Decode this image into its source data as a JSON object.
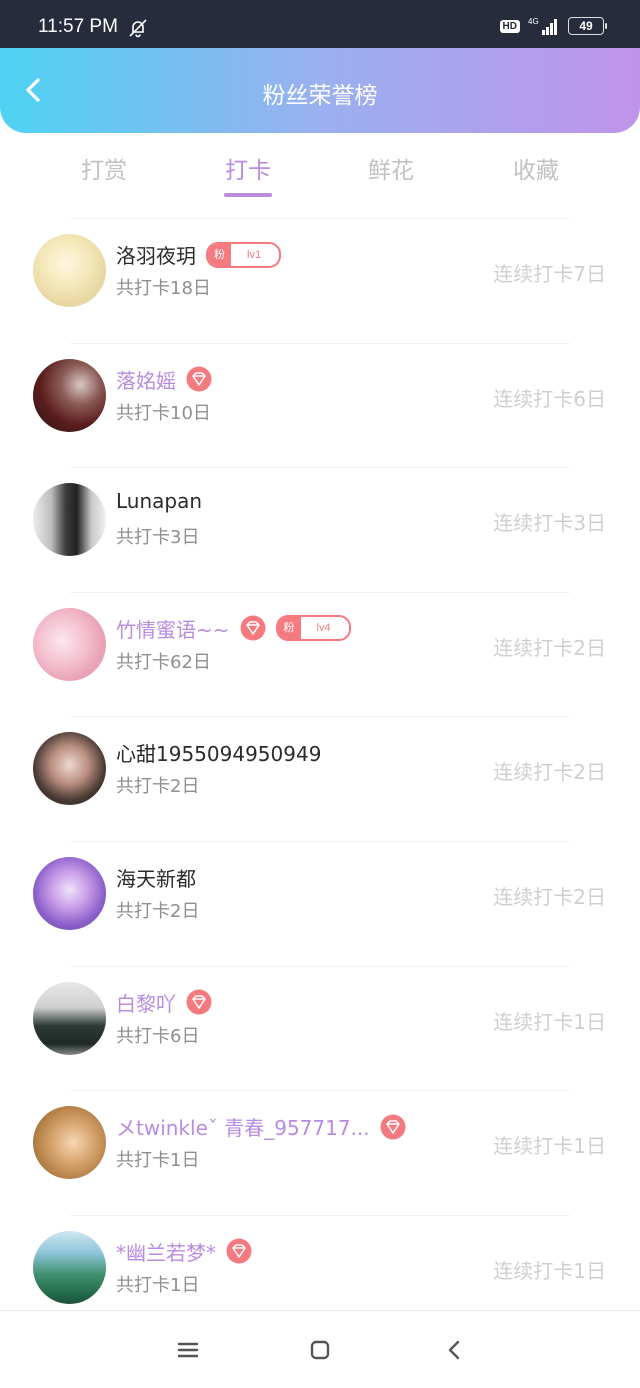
{
  "status_bar": {
    "time": "11:57 PM",
    "mute_icon": "bell-off-icon",
    "hd": "HD",
    "network": "4G",
    "battery": "49"
  },
  "header": {
    "title": "粉丝荣誉榜",
    "back_icon": "chevron-left-icon"
  },
  "tabs": [
    {
      "label": "打赏",
      "active": false
    },
    {
      "label": "打卡",
      "active": true
    },
    {
      "label": "鲜花",
      "active": false
    },
    {
      "label": "收藏",
      "active": false
    }
  ],
  "colors": {
    "accent": "#b88ce1",
    "badge": "#f47a80",
    "header_start": "#4dd3f3",
    "header_end": "#bf94ea"
  },
  "fans": [
    {
      "name": "洛羽夜玥",
      "vip": false,
      "diamond": false,
      "fan_badge": {
        "label": "粉",
        "level": "lv1"
      },
      "total": "共打卡18日",
      "streak": "连续打卡7日"
    },
    {
      "name": "落姳媱",
      "vip": true,
      "diamond": true,
      "fan_badge": null,
      "total": "共打卡10日",
      "streak": "连续打卡6日"
    },
    {
      "name": "Lunapan",
      "vip": false,
      "diamond": false,
      "fan_badge": null,
      "total": "共打卡3日",
      "streak": "连续打卡3日"
    },
    {
      "name": "竹情蜜语~~",
      "vip": true,
      "diamond": true,
      "fan_badge": {
        "label": "粉",
        "level": "lv4"
      },
      "total": "共打卡62日",
      "streak": "连续打卡2日"
    },
    {
      "name": "心甜1955094950949",
      "vip": false,
      "diamond": false,
      "fan_badge": null,
      "total": "共打卡2日",
      "streak": "连续打卡2日"
    },
    {
      "name": "海天新都",
      "vip": false,
      "diamond": false,
      "fan_badge": null,
      "total": "共打卡2日",
      "streak": "连续打卡2日"
    },
    {
      "name": "白黎吖",
      "vip": true,
      "diamond": true,
      "fan_badge": null,
      "total": "共打卡6日",
      "streak": "连续打卡1日"
    },
    {
      "name": "メtwinkleˇ 青春_957717...",
      "vip": true,
      "diamond": true,
      "fan_badge": null,
      "total": "共打卡1日",
      "streak": "连续打卡1日"
    },
    {
      "name": "*幽兰若梦*",
      "vip": true,
      "diamond": true,
      "fan_badge": null,
      "total": "共打卡1日",
      "streak": "连续打卡1日"
    }
  ],
  "nav_bar": {
    "icons": [
      "menu-icon",
      "home-square-icon",
      "back-chevron-icon"
    ]
  }
}
